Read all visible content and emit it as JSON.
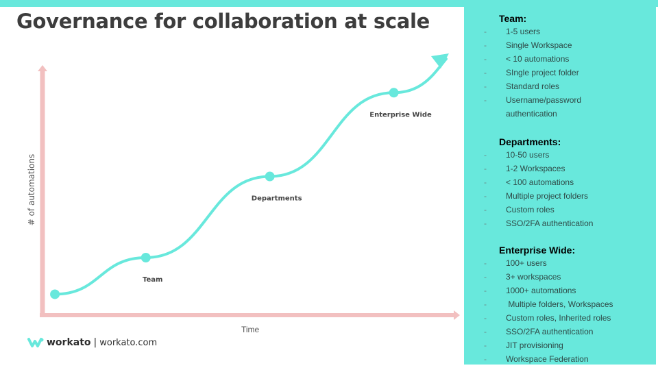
{
  "slide": {
    "title": "Governance for collaboration at scale",
    "accent_color": "#68e8dc",
    "axis_color": "#f2c0c0"
  },
  "chart_data": {
    "type": "line",
    "title": "Governance for collaboration at scale",
    "xlabel": "Time",
    "ylabel": "# of automations",
    "grid": false,
    "legend": "none",
    "trend": "increasing stepwise S-curve ending in upward arrow",
    "stages": [
      {
        "name": "Start",
        "label": "",
        "x": 0.03,
        "y": 0.08
      },
      {
        "name": "Team",
        "label": "Team",
        "x": 0.25,
        "y": 0.22
      },
      {
        "name": "Departments",
        "label": "Departments",
        "x": 0.55,
        "y": 0.53
      },
      {
        "name": "Enterprise Wide",
        "label": "Enterprise Wide",
        "x": 0.85,
        "y": 0.85
      },
      {
        "name": "End",
        "label": "",
        "x": 0.99,
        "y": 1.0
      }
    ]
  },
  "panel": {
    "sections": [
      {
        "heading": "Team:",
        "items": [
          "1-5 users",
          "Single Workspace",
          "< 10 automations",
          "SIngle  project folder",
          "Standard roles",
          "Username/password",
          "authentication"
        ]
      },
      {
        "heading": "Departments:",
        "items": [
          "10-50 users",
          "1-2 Workspaces",
          "< 100  automations",
          "Multiple project folders",
          "Custom roles",
          "SSO/2FA authentication"
        ]
      },
      {
        "heading": "Enterprise Wide:",
        "items": [
          "100+ users",
          "3+ workspaces",
          "1000+ automations",
          " Multiple folders, Workspaces",
          "Custom roles, Inherited roles",
          "SSO/2FA authentication",
          "JIT provisioning",
          "Workspace Federation"
        ]
      }
    ]
  },
  "footer": {
    "brand": "workato",
    "separator": "|",
    "url": "workato.com"
  }
}
